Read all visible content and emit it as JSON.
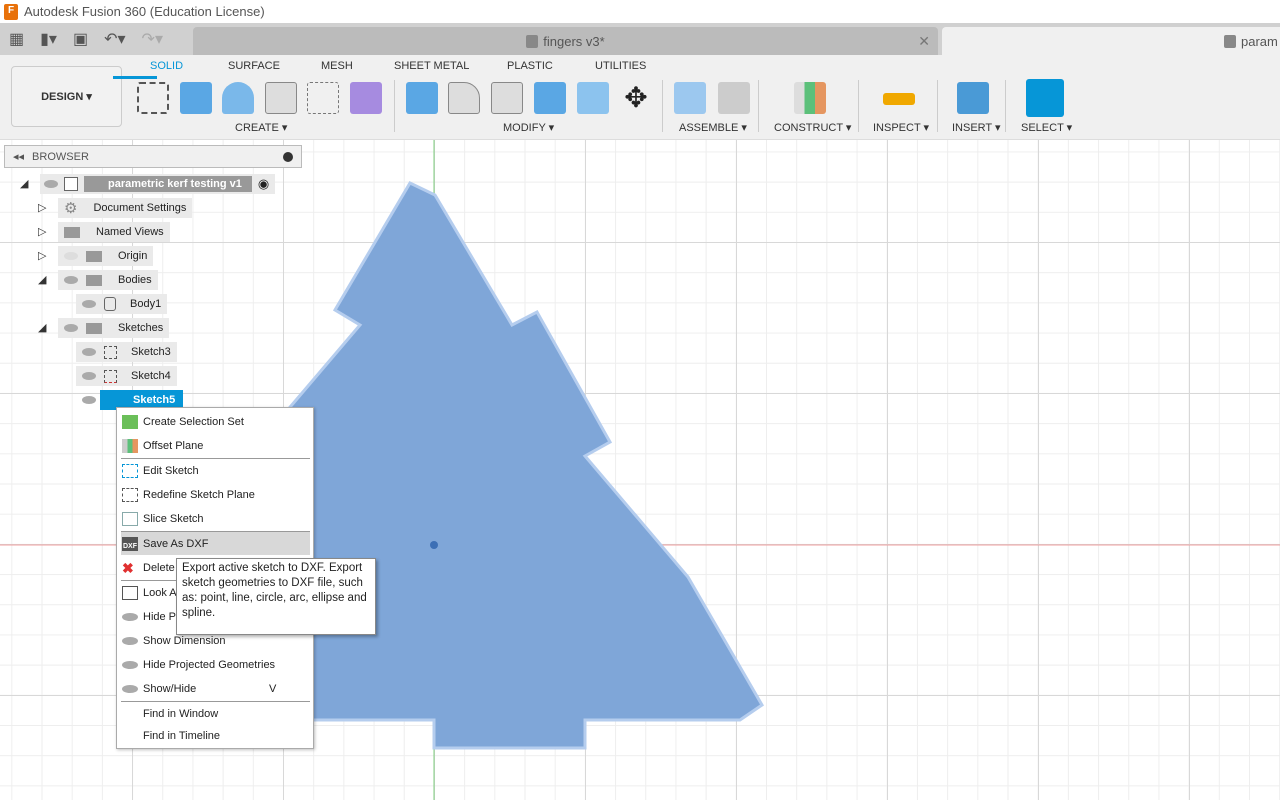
{
  "app": {
    "title": "Autodesk Fusion 360 (Education License)"
  },
  "tabs": [
    {
      "label": "fingers v3*",
      "active": false
    },
    {
      "label": "param",
      "active": true
    }
  ],
  "toolbar": {
    "workspace": "DESIGN",
    "tabs": [
      "SOLID",
      "SURFACE",
      "MESH",
      "SHEET METAL",
      "PLASTIC",
      "UTILITIES"
    ],
    "groups": [
      "CREATE",
      "MODIFY",
      "ASSEMBLE",
      "CONSTRUCT",
      "INSPECT",
      "INSERT",
      "SELECT"
    ],
    "accent": "#0696d7"
  },
  "browser": {
    "title": "BROWSER",
    "root": "parametric kerf testing v1",
    "items": [
      "Document Settings",
      "Named Views",
      "Origin",
      "Bodies",
      "Body1",
      "Sketches",
      "Sketch3",
      "Sketch4",
      "Sketch5"
    ]
  },
  "context_menu": {
    "items": [
      "Create Selection Set",
      "Offset Plane",
      "Edit Sketch",
      "Redefine Sketch Plane",
      "Slice Sketch",
      "Save As DXF",
      "Delete",
      "Look At",
      "Hide Profile",
      "Show Dimension",
      "Hide Projected Geometries",
      "Show/Hide",
      "Find in Window",
      "Find in Timeline"
    ],
    "shortcut_show_hide": "V",
    "highlighted": "Save As DXF"
  },
  "tooltip": {
    "text": "Export active sketch to DXF. Export sketch geometries to DXF file, such as: point, line, circle, arc, ellipse and spline."
  },
  "colors": {
    "body_fill": "#7fa6d8",
    "selection": "#0696d7"
  }
}
